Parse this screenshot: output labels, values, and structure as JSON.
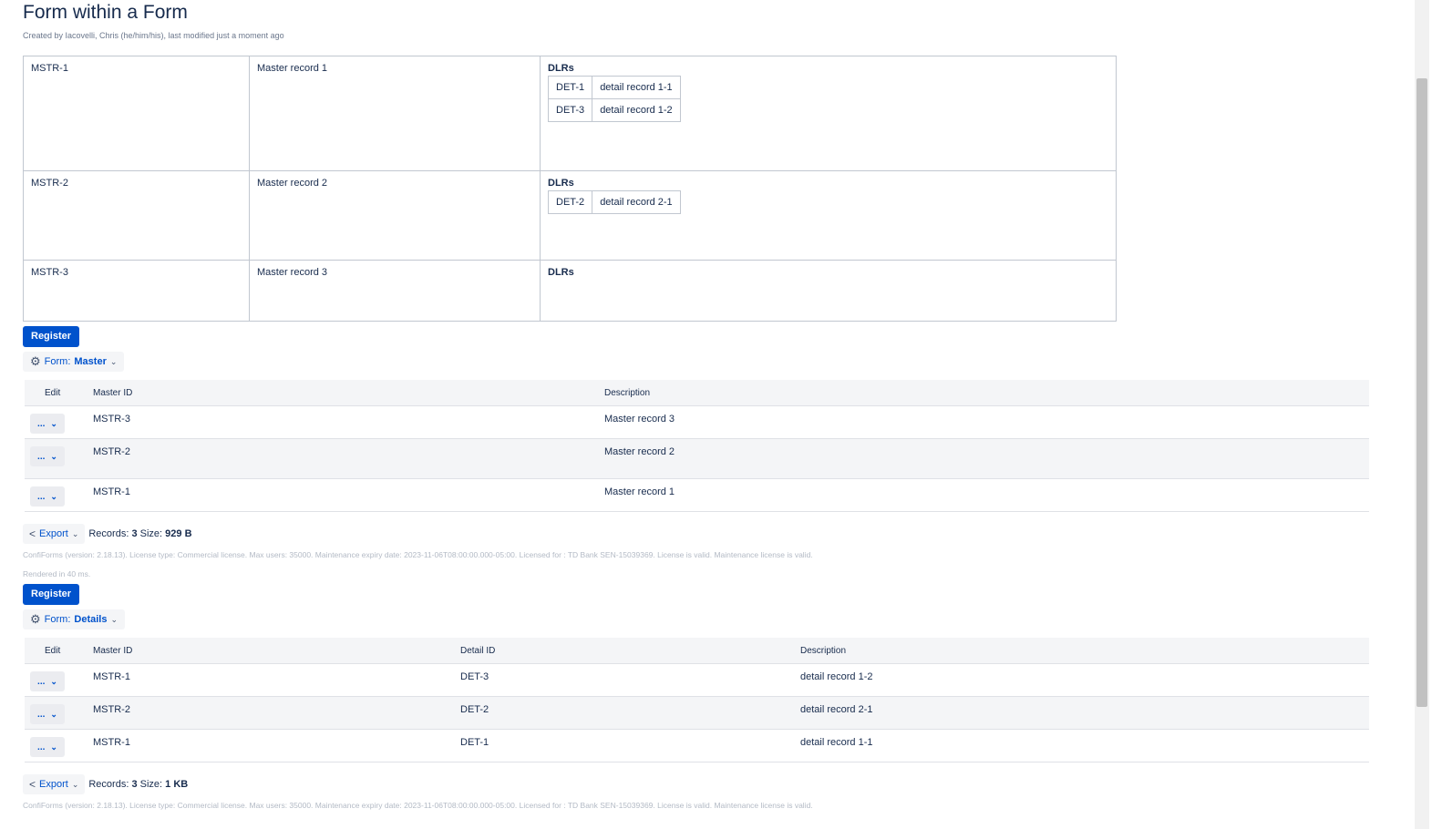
{
  "page": {
    "title": "Form within a Form",
    "byline": "Created by Iacovelli, Chris (he/him/his), last modified just a moment ago"
  },
  "master_detail": {
    "dlr_label": "DLRs",
    "rows": [
      {
        "id": "MSTR-1",
        "desc": "Master record 1",
        "details": [
          {
            "id": "DET-1",
            "desc": "detail record 1-1"
          },
          {
            "id": "DET-3",
            "desc": "detail record 1-2"
          }
        ]
      },
      {
        "id": "MSTR-2",
        "desc": "Master record 2",
        "details": [
          {
            "id": "DET-2",
            "desc": "detail record 2-1"
          }
        ]
      },
      {
        "id": "MSTR-3",
        "desc": "Master record 3",
        "details": []
      }
    ]
  },
  "master_form": {
    "register_label": "Register",
    "form_prefix": "Form:",
    "form_name": "Master",
    "columns": [
      "Edit",
      "Master ID",
      "Description"
    ],
    "rows": [
      {
        "master_id": "MSTR-3",
        "description": "Master record 3"
      },
      {
        "master_id": "MSTR-2",
        "description": "Master record 2"
      },
      {
        "master_id": "MSTR-1",
        "description": "Master record 1"
      }
    ],
    "edit_label": "...",
    "export_label": "Export",
    "records_label": "Records:",
    "records": "3",
    "size_label": "Size:",
    "size": "929 B",
    "license": "ConfiForms (version: 2.18.13). License type: Commercial license. Max users: 35000. Maintenance expiry date: 2023-11-06T08:00:00.000-05:00. Licensed for : TD Bank SEN-15039369. License is valid. Maintenance license is valid.",
    "rendered": "Rendered in 40 ms."
  },
  "details_form": {
    "register_label": "Register",
    "form_prefix": "Form:",
    "form_name": "Details",
    "columns": [
      "Edit",
      "Master ID",
      "Detail ID",
      "Description"
    ],
    "rows": [
      {
        "master_id": "MSTR-1",
        "detail_id": "DET-3",
        "description": "detail record 1-2"
      },
      {
        "master_id": "MSTR-2",
        "detail_id": "DET-2",
        "description": "detail record 2-1"
      },
      {
        "master_id": "MSTR-1",
        "detail_id": "DET-1",
        "description": "detail record 1-1"
      }
    ],
    "edit_label": "...",
    "export_label": "Export",
    "records_label": "Records:",
    "records": "3",
    "size_label": "Size:",
    "size": "1 KB",
    "license": "ConfiForms (version: 2.18.13). License type: Commercial license. Max users: 35000. Maintenance expiry date: 2023-11-06T08:00:00.000-05:00. Licensed for : TD Bank SEN-15039369. License is valid. Maintenance license is valid."
  },
  "colors": {
    "accent": "#0052cc",
    "text": "#172b4d",
    "header_bg": "#f4f5f7"
  },
  "icons": {
    "gear": "gear-icon",
    "chevron": "chevron-down-icon",
    "share": "share-icon"
  }
}
